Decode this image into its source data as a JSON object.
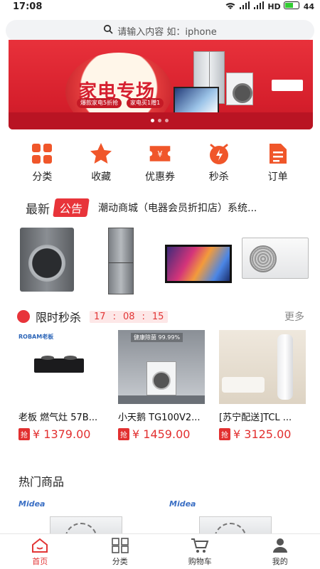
{
  "status_bar": {
    "time": "17:08",
    "network": "HD",
    "battery": "44"
  },
  "search": {
    "placeholder": "请输入内容 如：iphone"
  },
  "banner": {
    "title": "家电专场",
    "tag1": "爆款家电5折抢",
    "tag2": "家电买1赠1"
  },
  "quick_menu": [
    {
      "label": "分类",
      "icon": "grid-icon"
    },
    {
      "label": "收藏",
      "icon": "star-icon"
    },
    {
      "label": "优惠券",
      "icon": "coupon-icon"
    },
    {
      "label": "秒杀",
      "icon": "flash-icon"
    },
    {
      "label": "订单",
      "icon": "order-icon"
    }
  ],
  "notice": {
    "prefix": "最新",
    "badge": "公告",
    "text": "潮动商城（电器会员折扣店）系统..."
  },
  "flash_sale": {
    "title": "限时秒杀",
    "time": [
      "17",
      ":",
      "08",
      ":",
      "15"
    ],
    "more": "更多",
    "items": [
      {
        "name": "老板 燃气灶 57B...",
        "badge": "抢",
        "price": "¥ 1379.00"
      },
      {
        "name": "小天鹅 TG100V2...",
        "badge": "抢",
        "price": "¥ 1459.00"
      },
      {
        "name": "[苏宁配送]TCL ...",
        "badge": "抢",
        "price": "¥ 3125.00"
      }
    ],
    "item_texts": {
      "robam": "ROBAM老板",
      "health": "健康除菌 99.99%"
    }
  },
  "hot": {
    "title": "热门商品",
    "brand": "Midea"
  },
  "tabbar": [
    {
      "label": "首页",
      "icon": "home-icon",
      "active": true
    },
    {
      "label": "分类",
      "icon": "grid-icon"
    },
    {
      "label": "购物车",
      "icon": "cart-icon"
    },
    {
      "label": "我的",
      "icon": "user-icon"
    }
  ],
  "colors": {
    "accent": "#e23636",
    "orange": "#f0562a"
  }
}
